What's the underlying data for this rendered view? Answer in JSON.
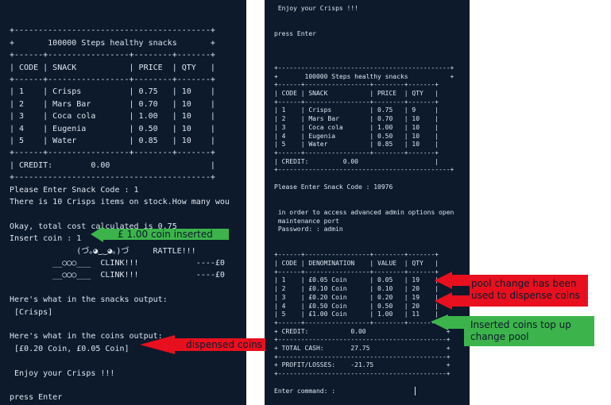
{
  "left_terminal": {
    "lines": [
      "",
      "+-----------------------------------------+",
      "+       100000 Steps healthy snacks       +",
      "+------+-----------------+--------+-------+",
      "| CODE | SNACK           | PRICE  | QTY   |",
      "+------+-----------------+--------+-------+",
      "| 1    | Crisps          | 0.75   | 10    |",
      "| 2    | Mars Bar        | 0.70   | 10    |",
      "| 3    | Coca cola       | 1.00   | 10    |",
      "| 4    | Eugenia         | 0.50   | 10    |",
      "| 5    | Water           | 0.85   | 10    |",
      "+------+-----------------+--------+-------+",
      "| CREDIT:        0.00                     |",
      "+-----------------------------------------+",
      "Please Enter Snack Code : 1",
      "There is 10 Crisps items on stock.How many wou",
      "",
      "Okay, total cost calculated is 0.75",
      "Insert coin : 1",
      "              (づ｡◕‿‿◕｡)づ     RATTLE!!!",
      "         __○◯○___  CLINK!!!            ----£0",
      "         __○◯○___  CLINK!!!            ----£0",
      "",
      "Here's what in the snacks output:",
      " [Crisps]",
      "",
      "Here's what in the coins output:",
      " [£0.20 Coin, £0.05 Coin]",
      "",
      " Enjoy your Crisps !!!",
      "",
      "press Enter"
    ]
  },
  "right_terminal": {
    "lines": [
      " Enjoy your Crisps !!!",
      "",
      "",
      "press Enter",
      "",
      "",
      "",
      "+---------------------------------------------+",
      "+       100000 Steps healthy snacks           +",
      "+------+-----------------+--------+-------+",
      "| CODE | SNACK           | PRICE  | QTY   |",
      "+------+-----------------+--------+-------+",
      "| 1    | Crisps          | 0.75   | 9     |",
      "| 2    | Mars Bar        | 0.70   | 10    |",
      "| 3    | Coca cola       | 1.00   | 10    |",
      "| 4    | Eugenia         | 0.50   | 10    |",
      "| 5    | Water           | 0.85   | 10    |",
      "+------+-----------------+--------+-------+",
      "| CREDIT:         0.00                    |",
      "+---------------------------------------------+",
      "",
      "Please Enter Snack Code : 10976",
      "",
      "",
      " in order to access advanced admin options open",
      " maintenance port",
      " Password: : admin",
      "",
      "",
      "+------+-----------------+--------+-------+",
      "| CODE | DENOMINATION    | VALUE  | QTY   |",
      "+------+-----------------+--------+-------+",
      "| 1    | £0.05 Coin      | 0.05   | 19    |",
      "| 2    | £0.10 Coin      | 0.10   | 20    |",
      "| 3    | £0.20 Coin      | 0.20   | 19    |",
      "| 4    | £0.50 Coin      | 0.50   | 20    |",
      "| 5    | £1.00 Coin      | 1.00   | 11    |",
      "+------+-----------------+--------+-------+",
      "+ CREDIT:           0.00                     +",
      "+--------------------------------------------+",
      "+ TOTAL CASH:       27.75                    +",
      "+--------------------------------------------+",
      "+ PROFIT/LOSSES:    -21.75                   +",
      "+--------------------------------------------+",
      "",
      "Enter command: :"
    ]
  },
  "annotations": {
    "coin_inserted": "£ 1.00 coin inserted",
    "dispensed_coins": "dispensed coins",
    "pool_change": "pool change has been\nused to dispense coins",
    "top_up": "Inserted coins top up\nchange pool"
  },
  "colors": {
    "terminal_bg": "#0c1a2c",
    "terminal_text": "#dfe6ee",
    "annotation_green": "#3cb44b",
    "annotation_red": "#e8101e"
  }
}
